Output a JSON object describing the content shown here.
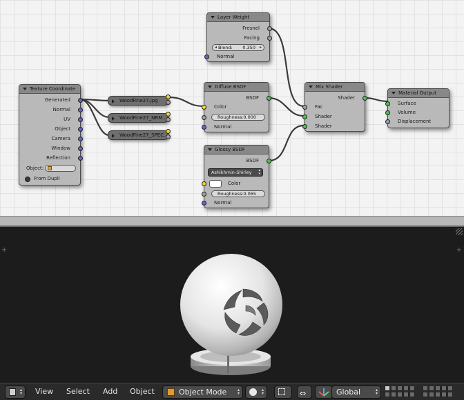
{
  "nodes": {
    "layer_weight": {
      "title": "Layer Weight",
      "outputs": [
        "Fresnel",
        "Facing"
      ],
      "blend_label": "Blend:",
      "blend_value": "0.350",
      "input": "Normal"
    },
    "diffuse": {
      "title": "Diffuse BSDF",
      "output": "BSDF",
      "color_label": "Color",
      "roughness_label": "Roughness:",
      "roughness_value": "0.000",
      "normal_label": "Normal"
    },
    "glossy": {
      "title": "Glossy BSDF",
      "output": "BSDF",
      "distribution": "Ashikhmin-Shirley",
      "color_label": "Color",
      "roughness_label": "Roughness:",
      "roughness_value": "0.065",
      "normal_label": "Normal"
    },
    "mix": {
      "title": "Mix Shader",
      "output": "Shader",
      "inputs": [
        "Fac",
        "Shader",
        "Shader"
      ]
    },
    "output": {
      "title": "Material Output",
      "inputs": [
        "Surface",
        "Volume",
        "Displacement"
      ]
    },
    "texcoord": {
      "title": "Texture Coordinate",
      "outputs": [
        "Generated",
        "Normal",
        "UV",
        "Object",
        "Camera",
        "Window",
        "Reflection"
      ],
      "object_label": "Object:",
      "from_dupli": "From Dupli"
    },
    "textures": [
      "WoodFine27.jpg",
      "WoodFine27_NRM....",
      "WoodFine27_SPEC...."
    ]
  },
  "header": {
    "menus": [
      "View",
      "Select",
      "Add",
      "Object"
    ],
    "mode": "Object Mode",
    "orientation": "Global"
  },
  "colors": {
    "socket_yellow": "#e4d83e",
    "socket_gray": "#9f9f9f",
    "socket_blue": "#6364c8",
    "socket_green": "#4ec24e"
  }
}
